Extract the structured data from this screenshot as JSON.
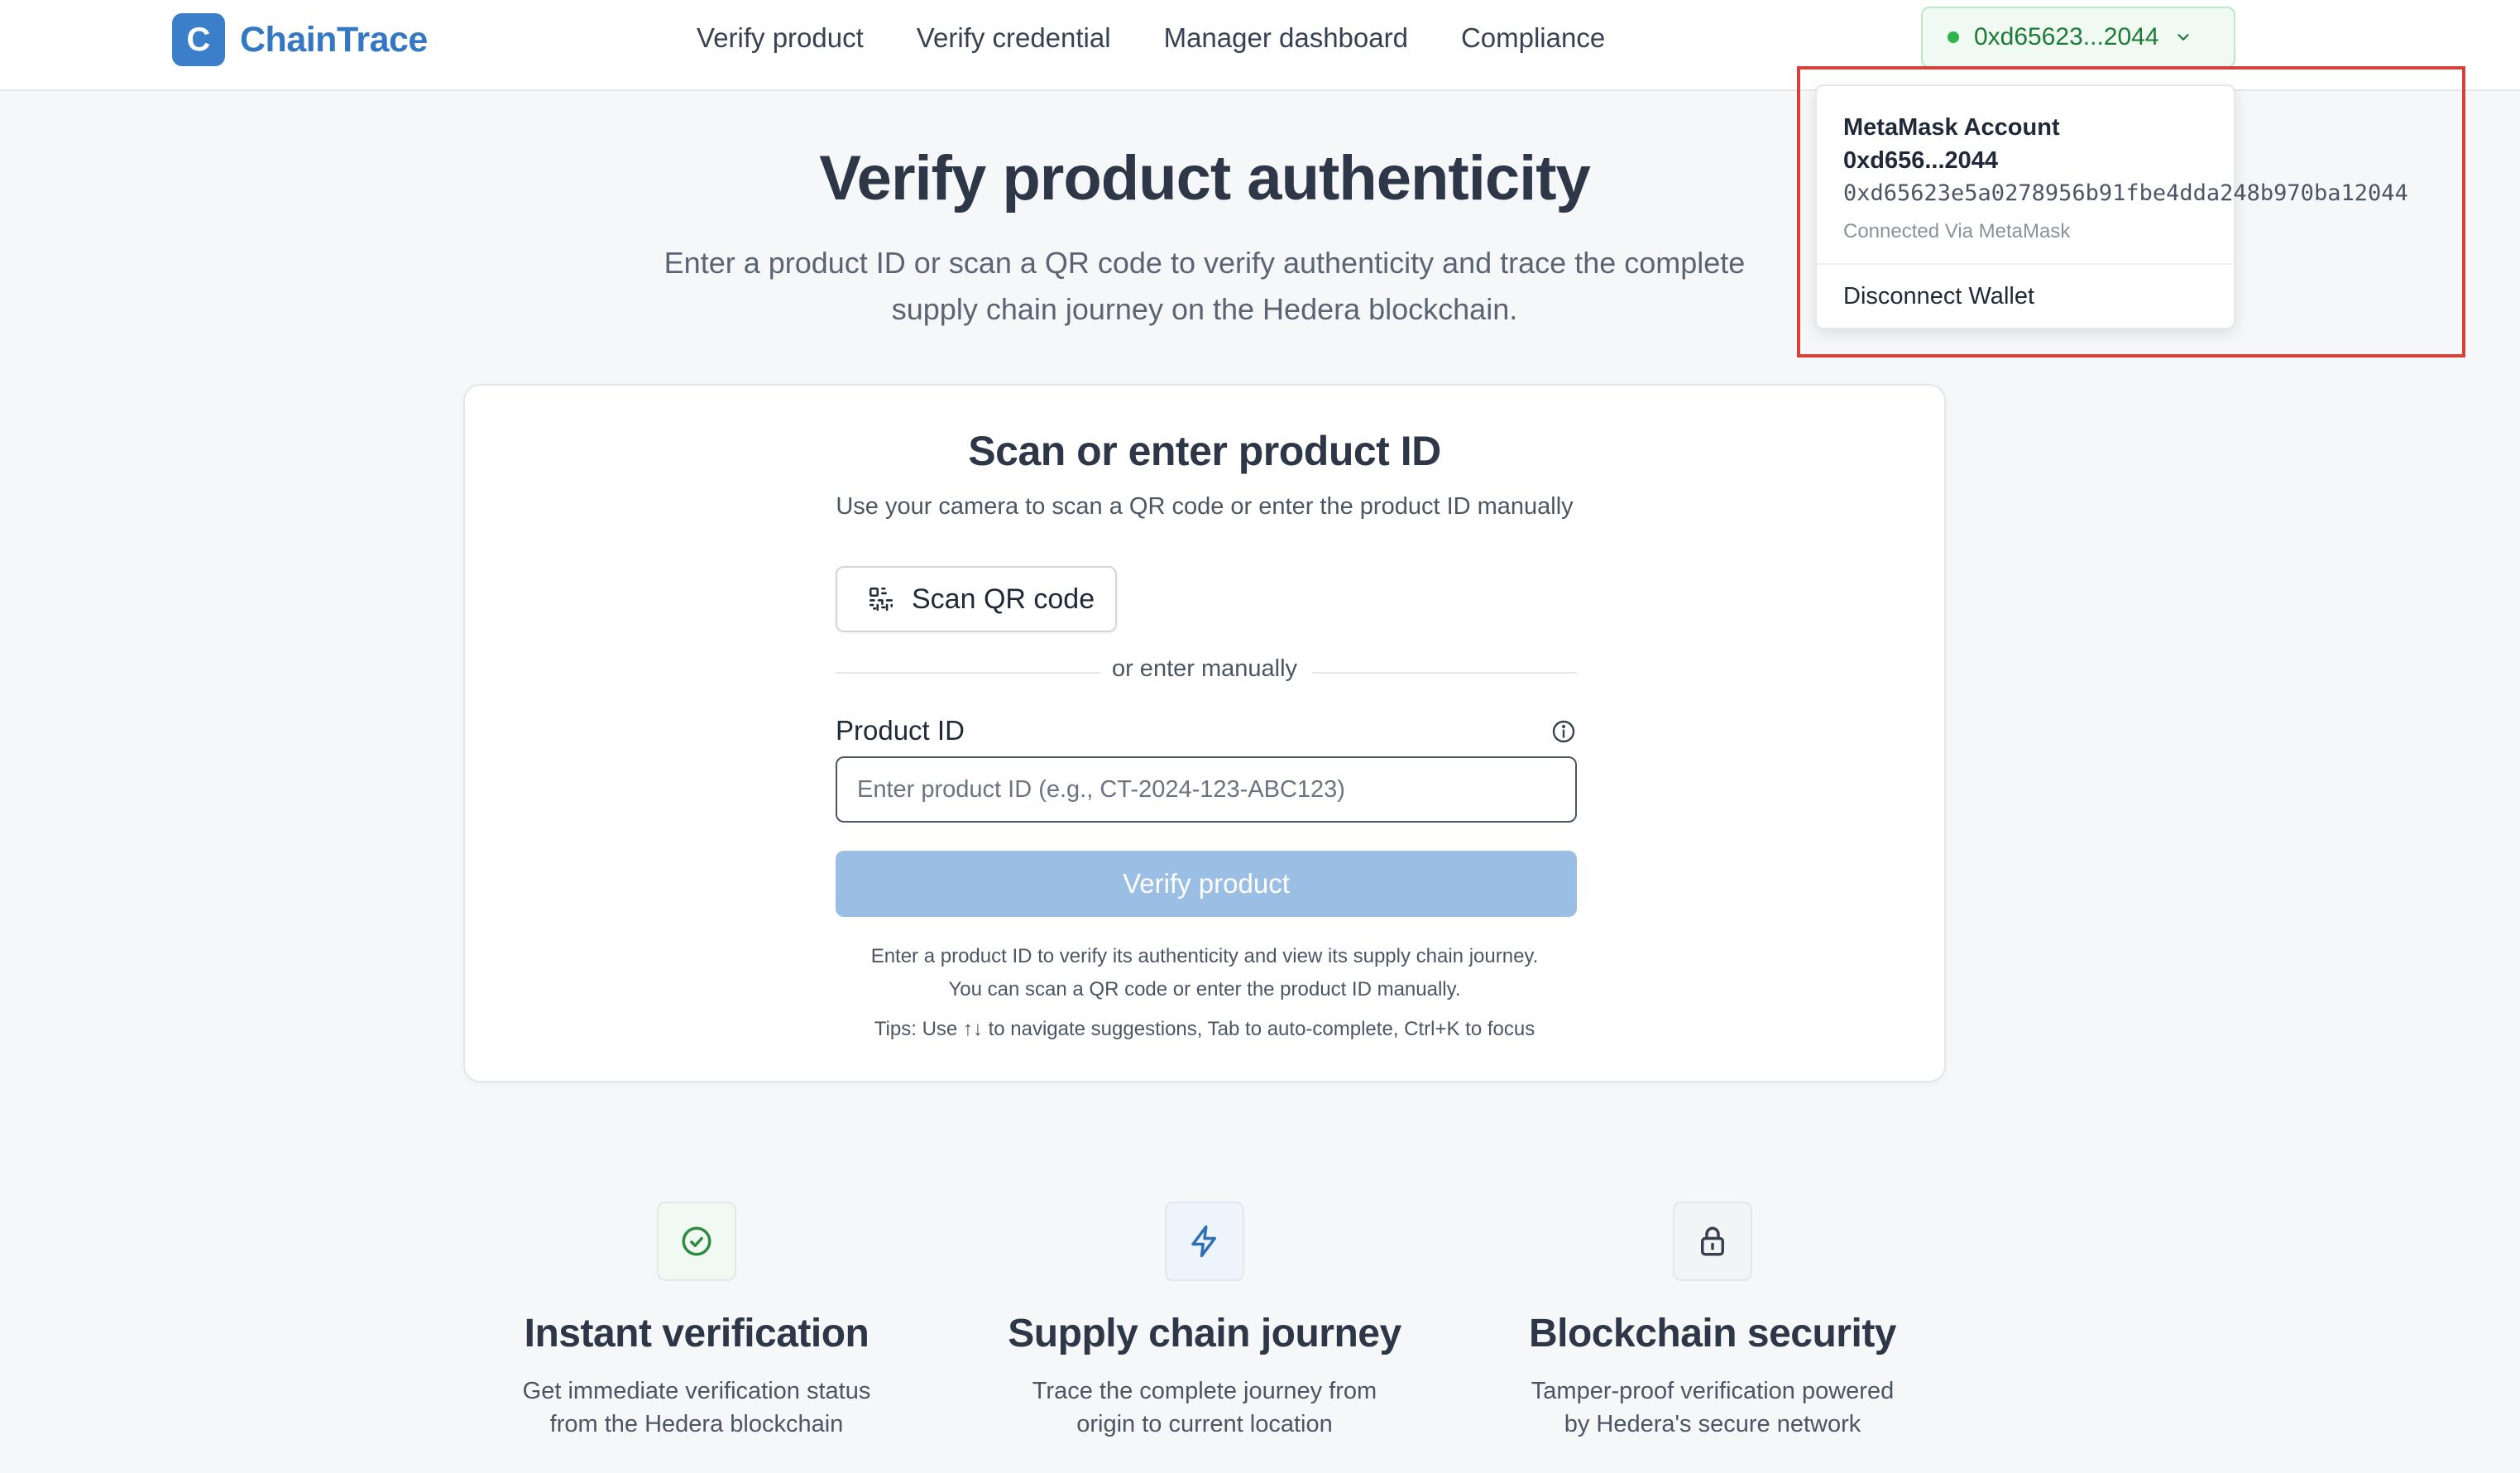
{
  "header": {
    "logo_letter": "C",
    "brand": "ChainTrace",
    "nav": [
      "Verify product",
      "Verify credential",
      "Manager dashboard",
      "Compliance"
    ],
    "wallet_short": "0xd65623...2044",
    "wallet_status_color": "#2fb54f"
  },
  "hero": {
    "title": "Verify product authenticity",
    "subtitle": "Enter a product ID or scan a QR code to verify authenticity and trace the complete supply chain journey on the Hedera blockchain."
  },
  "card": {
    "title": "Scan or enter product ID",
    "subtitle": "Use your camera to scan a QR code or enter the product ID manually",
    "scan_label": "Scan QR code",
    "divider": "or enter manually",
    "field_label": "Product ID",
    "input_value": "",
    "input_placeholder": "Enter product ID (e.g., CT-2024-123-ABC123)",
    "verify_label": "Verify product",
    "help_line1": "Enter a product ID to verify its authenticity and view its supply chain journey.",
    "help_line2": "You can scan a QR code or enter the product ID manually.",
    "tips": "Tips: Use ↑↓ to navigate suggestions, Tab to auto-complete, Ctrl+K to focus"
  },
  "features": [
    {
      "icon": "check-circle-icon",
      "title": "Instant verification",
      "desc": "Get immediate verification status from the Hedera blockchain",
      "icon_color": "#2f8a43",
      "bg": "#f0faf2"
    },
    {
      "icon": "lightning-icon",
      "title": "Supply chain journey",
      "desc": "Trace the complete journey from origin to current location",
      "icon_color": "#2f6fb5",
      "bg": "#eef4fb"
    },
    {
      "icon": "lock-icon",
      "title": "Blockchain security",
      "desc": "Tamper-proof verification powered by Hedera's secure network",
      "icon_color": "#374151",
      "bg": "#f3f4f6"
    }
  ],
  "dropdown": {
    "account_label": "MetaMask Account",
    "short_address": "0xd656...2044",
    "full_address": "0xd65623e5a0278956b91fbe4dda248b970ba12044",
    "connected_via": "Connected Via MetaMask",
    "disconnect_label": "Disconnect Wallet"
  },
  "colors": {
    "brand": "#3478c4",
    "verify_disabled": "#9bbfe4",
    "highlight": "#d9403a"
  }
}
